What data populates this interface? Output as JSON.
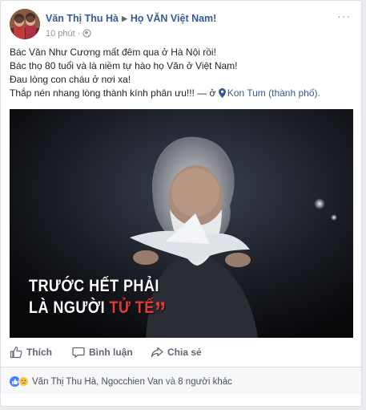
{
  "post": {
    "author": "Văn Thị Thu Hà",
    "group": "Họ VĂN Việt Nam!",
    "time": "10 phút",
    "dot": "·",
    "more_icon": "more-horizontal-icon",
    "lines": [
      "Bác Văn Như Cương mất đêm qua ở Hà Nội rồi!",
      "Bác thọ 80 tuổi và là niềm tự hào họ Văn ở Việt Nam!",
      "Đau lòng con cháu ở nơi xa!"
    ],
    "last_line": "Thắp nén nhang lòng thành kính phân ưu!!! — ở ",
    "place": "Kon Tum (thành phố).",
    "link_color": "#365899"
  },
  "photo": {
    "caption_line1": "TRƯỚC HẾT PHẢI",
    "caption_line2_prefix": "LÀ NGƯỜI ",
    "caption_line2_highlight": "TỬ TẾ",
    "caption_quote": "”",
    "highlight_color": "#e53935"
  },
  "actions": {
    "like": "Thích",
    "comment": "Bình luận",
    "share": "Chia sẻ"
  },
  "reactions": {
    "icons": [
      "like-reaction-icon",
      "sad-reaction-icon"
    ],
    "names": "Văn Thị Thu Hà, Ngocchien Van",
    "joiner": " và ",
    "others": "8 người khác"
  }
}
